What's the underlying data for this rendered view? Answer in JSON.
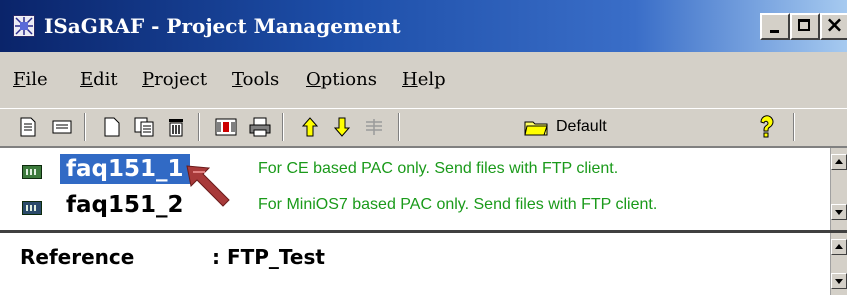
{
  "window": {
    "title": "ISaGRAF - Project Management",
    "app_icon": "isagraf-app-icon",
    "buttons": {
      "minimize": "minimize-button",
      "maximize": "maximize-button",
      "close": "close-button"
    }
  },
  "menu": {
    "items": [
      "File",
      "Edit",
      "Project",
      "Tools",
      "Options",
      "Help"
    ]
  },
  "toolbar": {
    "icons": [
      "edit-project-icon",
      "properties-icon",
      "new-project-icon",
      "copy-project-icon",
      "delete-project-icon",
      "archive-icon",
      "print-icon",
      "move-up-icon",
      "move-down-icon",
      "list-icon",
      "default-folder-icon",
      "help-icon"
    ],
    "default_label": "Default"
  },
  "projects": [
    {
      "name": "faq151_1",
      "description": "For CE based PAC only. Send files with FTP client.",
      "selected": true
    },
    {
      "name": "faq151_2",
      "description": "For MiniOS7 based PAC only. Send files with FTP client.",
      "selected": false
    }
  ],
  "reference": {
    "label": "Reference",
    "value": ": FTP_Test"
  },
  "colors": {
    "title_gradient_start": "#0a246a",
    "title_gradient_end": "#a6caf0",
    "selection": "#316ac5",
    "description_text": "#1a9a1a",
    "annotation_arrow": "#a83a3a"
  }
}
